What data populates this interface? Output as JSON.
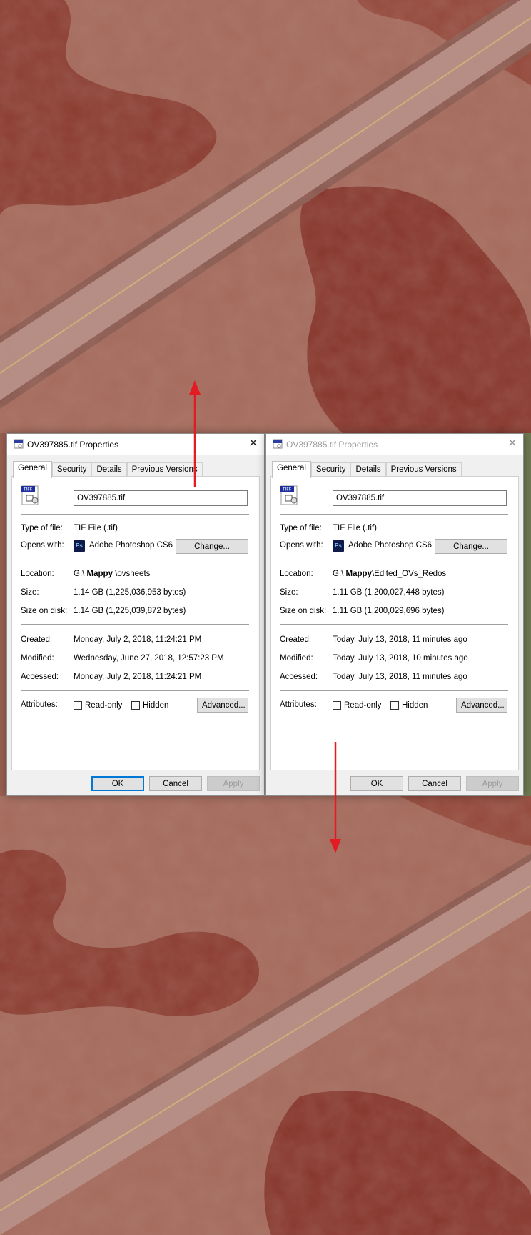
{
  "colors": {
    "water": "#8a3a2e",
    "land": "#a36a5c",
    "road": "#b58c84",
    "arrow": "#e31b23",
    "focus_blue": "#0078d7"
  },
  "dialogs": [
    {
      "title": "OV397885.tif Properties",
      "tabs": [
        "General",
        "Security",
        "Details",
        "Previous Versions"
      ],
      "filename": "OV397885.tif",
      "type_label": "Type of file:",
      "type_value": "TIF File (.tif)",
      "opens_label": "Opens with:",
      "opens_app": "Adobe Photoshop CS6",
      "change_label": "Change...",
      "location_label": "Location:",
      "location_prefix": "G:\\",
      "location_bold": "Mappy",
      "location_suffix": "\\ovsheets",
      "size_label": "Size:",
      "size_value": "1.14 GB (1,225,036,953 bytes)",
      "disk_label": "Size on disk:",
      "disk_value": "1.14 GB (1,225,039,872 bytes)",
      "created_label": "Created:",
      "created_value": "Monday, July 2, 2018, 11:24:21 PM",
      "modified_label": "Modified:",
      "modified_value": "Wednesday, June 27, 2018, 12:57:23 PM",
      "accessed_label": "Accessed:",
      "accessed_value": "Monday, July 2, 2018, 11:24:21 PM",
      "attributes_label": "Attributes:",
      "readonly_label": "Read-only",
      "hidden_label": "Hidden",
      "advanced_label": "Advanced...",
      "ok_label": "OK",
      "cancel_label": "Cancel",
      "apply_label": "Apply"
    },
    {
      "title": "OV397885.tif Properties",
      "tabs": [
        "General",
        "Security",
        "Details",
        "Previous Versions"
      ],
      "filename": "OV397885.tif",
      "type_label": "Type of file:",
      "type_value": "TIF File (.tif)",
      "opens_label": "Opens with:",
      "opens_app": "Adobe Photoshop CS6",
      "change_label": "Change...",
      "location_label": "Location:",
      "location_prefix": "G:\\",
      "location_bold": "Mappy",
      "location_suffix": "\\Edited_OVs_Redos",
      "size_label": "Size:",
      "size_value": "1.11 GB (1,200,027,448 bytes)",
      "disk_label": "Size on disk:",
      "disk_value": "1.11 GB (1,200,029,696 bytes)",
      "created_label": "Created:",
      "created_value": "Today, July 13, 2018, 11 minutes ago",
      "modified_label": "Modified:",
      "modified_value": "Today, July 13, 2018, 10 minutes ago",
      "accessed_label": "Accessed:",
      "accessed_value": "Today, July 13, 2018, 11 minutes ago",
      "attributes_label": "Attributes:",
      "readonly_label": "Read-only",
      "hidden_label": "Hidden",
      "advanced_label": "Advanced...",
      "ok_label": "OK",
      "cancel_label": "Cancel",
      "apply_label": "Apply"
    }
  ],
  "icons": {
    "file_badge": "TIFF",
    "ps_badge": "Ps"
  }
}
